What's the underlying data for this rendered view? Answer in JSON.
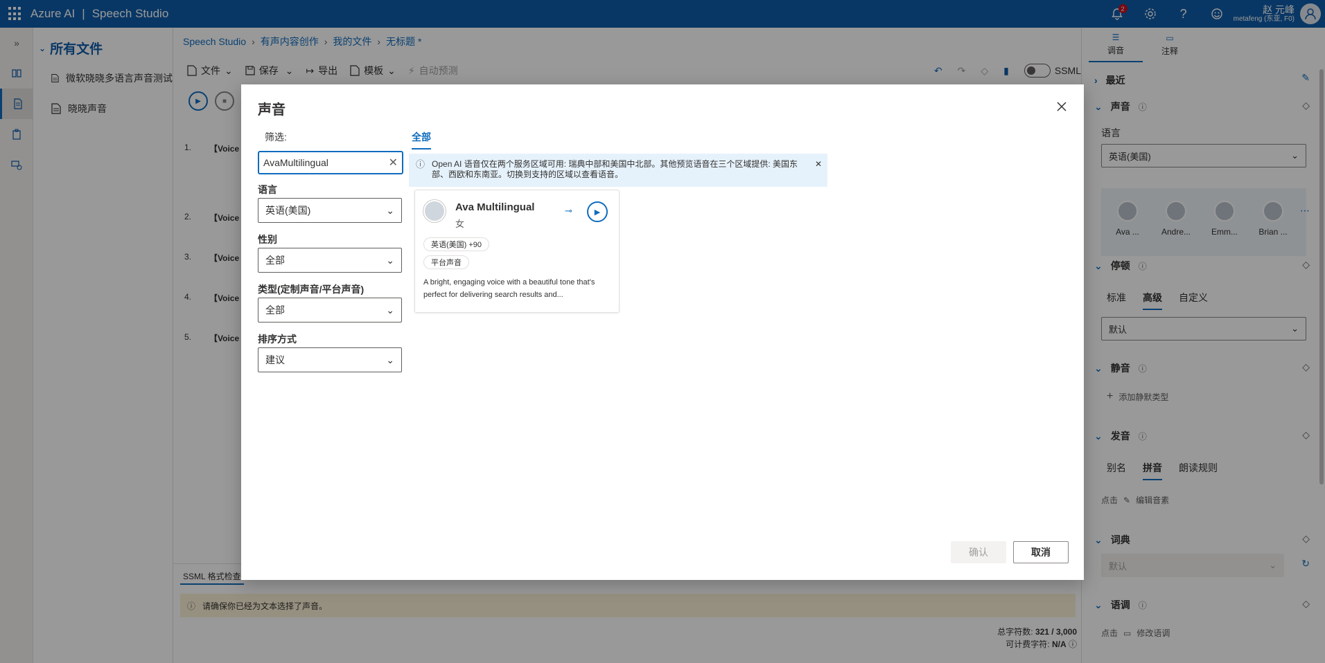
{
  "topbar": {
    "brand": "Azure AI",
    "product": "Speech Studio",
    "notif_count": "2",
    "user_name": "赵 元峰",
    "user_sub": "metafeng (东亚, F0)"
  },
  "filepanel": {
    "title": "所有文件",
    "files": [
      "微软晓晓多语言声音测试",
      "晓晓声音"
    ]
  },
  "breadcrumb": [
    "Speech Studio",
    "有声内容创作",
    "我的文件",
    "无标题 *"
  ],
  "toolbar": {
    "file": "文件",
    "save": "保存",
    "export": "导出",
    "template": "模板",
    "autopredict": "自动预测",
    "ssml": "SSML"
  },
  "editor": {
    "lines": [
      {
        "num": "1.",
        "text": "【Voice n"
      },
      {
        "num": "2.",
        "text": "【Voice n"
      },
      {
        "num": "3.",
        "text": "【Voice n"
      },
      {
        "num": "4.",
        "text": "【Voice n"
      },
      {
        "num": "5.",
        "text": "【Voice n"
      }
    ],
    "ssml_tab": "SSML 格式检查",
    "warning": "请确保你已经为文本选择了声音。",
    "total_chars_label": "总字符数:",
    "total_chars": "321 / 3,000",
    "billable_label": "可计费字符:",
    "billable": "N/A"
  },
  "rightpanel": {
    "tabs": [
      "调音",
      "注释"
    ],
    "recent": "最近",
    "voice": "声音",
    "language_label": "语言",
    "language_value": "英语(美国)",
    "voices": [
      "Ava ...",
      "Andre...",
      "Emm...",
      "Brian ..."
    ],
    "pause": "停顿",
    "pause_tabs": [
      "标准",
      "高级",
      "自定义"
    ],
    "pause_value": "默认",
    "silence": "静音",
    "add_silence": "添加静默类型",
    "pronunciation": "发音",
    "pron_tabs": [
      "别名",
      "拼音",
      "朗读规则"
    ],
    "click": "点击",
    "edit_phoneme": "编辑音素",
    "lexicon": "词典",
    "lexicon_value": "默认",
    "intonation": "语调",
    "edit_intonation": "修改语调"
  },
  "dialog": {
    "title": "声音",
    "filter_label": "筛选:",
    "search_value": "AvaMultilingual",
    "language_label": "语言",
    "language_value": "英语(美国)",
    "gender_label": "性别",
    "gender_value": "全部",
    "type_label": "类型(定制声音/平台声音)",
    "type_value": "全部",
    "sort_label": "排序方式",
    "sort_value": "建议",
    "tab_all": "全部",
    "info": "Open AI 语音仅在两个服务区域可用: 瑞典中部和美国中北部。其他预览语音在三个区域提供: 美国东部、西欧和东南亚。切换到支持的区域以查看语音。",
    "card": {
      "name": "Ava Multilingual",
      "gender": "女",
      "lang_chip": "英语(美国) +90",
      "type_chip": "平台声音",
      "desc": "A bright, engaging voice with a beautiful tone that's perfect for delivering search results and..."
    },
    "confirm": "确认",
    "cancel": "取消"
  },
  "colors": {
    "topbar": "#0f5ca8",
    "accent": "#0f6cbd",
    "badge": "#c50f1f",
    "warning_bg": "#fbf1d6",
    "info_bg": "#e6f2fb"
  }
}
